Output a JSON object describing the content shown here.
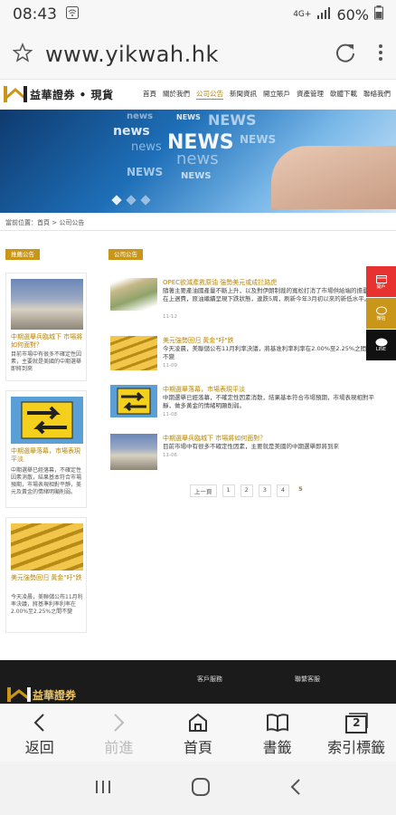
{
  "status": {
    "time": "08:43",
    "network": "4G+",
    "battery": "60%"
  },
  "browser": {
    "url": "www.yikwah.hk"
  },
  "site": {
    "brand": "益華證券 • 現貨",
    "menu": [
      "首頁",
      "關於我們",
      "公司公告",
      "新聞資訊",
      "開立賬戶",
      "資產管理",
      "軟體下載",
      "聯絡我們"
    ],
    "active_menu": "公司公告",
    "breadcrumb": "當前位置：首頁 > 公司公告",
    "left_tag": "推薦公告",
    "right_tag": "公司公告",
    "left_cards": [
      {
        "title": "中期選舉兵臨城下 市場將如何面對？",
        "desc": "目前市場中有很多不確定性因素，主要就是美國的中期選舉即將到來"
      },
      {
        "title": "中期選舉落幕，市場表現平淡",
        "desc": "中期選舉已經落幕，不確定性因素消散，結果基本符合市場預期，市場表現相對平靜，美元及黃金的情緒明顯削弱。"
      },
      {
        "title": "美元強勢回归 黃金\"吁\"跌",
        "desc": "今天凌晨，美聯儲公布11月利率決議，將基準利率利率在2.00%至2.25%之間不變"
      }
    ],
    "news": [
      {
        "title": "OPEC欲減產救原油 強勢美元或成拦路虎",
        "desc": "隨著主要產油國產量不斷上升，以及對伊朗制裁的寬松打消了市場供給端的擔憂，在上週費，原油繼續呈現下跌狀態，連跌5周，刷新今年3月初以來的新低水平。",
        "date": "11-12"
      },
      {
        "title": "美元強勢回归 黃金\"吁\"跌",
        "desc": "今天凌晨，美聯儲公布11月利率決議，將基准利率利率在2.00%至2.25%之間保持不變",
        "date": "11-09"
      },
      {
        "title": "中期選舉落幕，市場表現平淡",
        "desc": "中期選舉已經落幕，不確定性因素消散，結果基本符合市場預期，市場表現相對平靜，做多黃金的情緒明顯削弱。",
        "date": "11-08"
      },
      {
        "title": "中期選舉兵臨城下 市場將如何面對？",
        "desc": "目前市場中有很多不確定性因素，主要就是美國的中期選舉即將到來",
        "date": "11-06"
      }
    ],
    "pager": [
      "上一頁",
      "1",
      "2",
      "3",
      "4",
      "5"
    ],
    "pager_current": "5",
    "side_buttons": [
      {
        "label": "開戶",
        "color": "#e8322f"
      },
      {
        "label": "微信",
        "color": "#c9961a"
      },
      {
        "label": "LINE",
        "color": "#111111"
      }
    ],
    "footer": {
      "brand": "益華證券",
      "col1": "客戶服務",
      "col2": "聯繫客服"
    },
    "banner_words": [
      "news",
      "NEWS",
      "NEWS",
      "news",
      "NEWS",
      "news",
      "NEWS",
      "NEWS",
      "news",
      "NEWS"
    ]
  },
  "bottom": {
    "back": "返回",
    "forward": "前進",
    "home": "首頁",
    "bookmarks": "書籤",
    "tabs": "索引標籤",
    "tab_count": "2"
  },
  "colors": {
    "gold": "#c9961a",
    "link": "#b8860b",
    "banner": "#1e6fb8"
  }
}
